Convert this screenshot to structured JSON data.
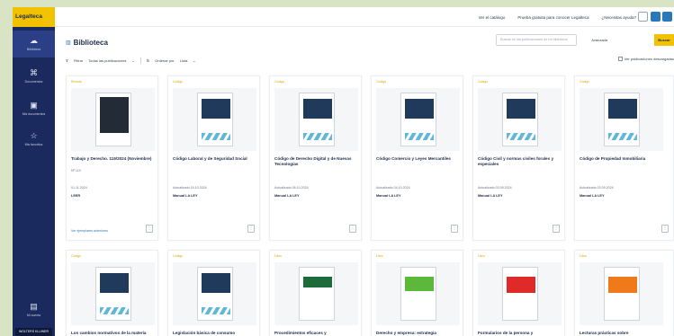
{
  "app": {
    "logo": "Legalteca"
  },
  "topbar": {
    "links": [
      "Ver el catálogo",
      "Prueba gratuita para conocer Legalteca",
      "¿Necesitas ayuda?"
    ]
  },
  "sidebar": {
    "items": [
      {
        "label": "Biblioteca",
        "icon": "cloud-icon"
      },
      {
        "label": "Documentos",
        "icon": "clip-icon"
      },
      {
        "label": "Mis documentos",
        "icon": "document-icon"
      },
      {
        "label": "Mis favoritos",
        "icon": "star-icon"
      }
    ],
    "bottom_item": {
      "label": "Mi cuenta",
      "icon": "archive-icon"
    },
    "bottom_logo": "WOLTERS KLUWER"
  },
  "main": {
    "title": "Biblioteca",
    "search_placeholder": "Buscar en las publicaciones de mi biblioteca",
    "advanced_search": "Avanzada",
    "search_button": "Buscar",
    "filter_label": "Filtrar",
    "filter_value": "Todas las publicaciones",
    "sort_label": "Ordenar por",
    "sort_value": "Lista",
    "show_all_label": "Ver publicaciones descargadas"
  },
  "cards": [
    {
      "tag": "Revista",
      "title": "Trabajo y Derecho. 119/2024 (Noviembre)",
      "sub": "Nº 119",
      "date": "01.11.2024",
      "access": "LEER",
      "more": "Ver ejemplares anteriores",
      "style": "dark"
    },
    {
      "tag": "Código",
      "title": "Código Laboral y de Seguridad Social",
      "sub": "",
      "date": "Actualizado 15.10.2024",
      "access": "Manual LA LEY",
      "more": "",
      "style": "code"
    },
    {
      "tag": "Código",
      "title": "Código de Derecho Digital y de Nuevas Tecnologías",
      "sub": "",
      "date": "Actualizado 06.10.2024",
      "access": "Manual LA LEY",
      "more": "",
      "style": "code"
    },
    {
      "tag": "Código",
      "title": "Código Comercio y Leyes Mercantiles",
      "sub": "",
      "date": "Actualizado 04.10.2024",
      "access": "Manual LA LEY",
      "more": "",
      "style": "code"
    },
    {
      "tag": "Código",
      "title": "Código Civil y normas civiles forales y especiales",
      "sub": "",
      "date": "Actualizado 03.09.2024",
      "access": "Manual LA LEY",
      "more": "",
      "style": "code"
    },
    {
      "tag": "Código",
      "title": "Código de Propiedad Inmobiliaria",
      "sub": "",
      "date": "Actualizado 03.09.2024",
      "access": "Manual LA LEY",
      "more": "",
      "style": "code"
    },
    {
      "tag": "Código",
      "title": "Los cambios normativos de la materia",
      "style": "code"
    },
    {
      "tag": "Código",
      "title": "Legislación básica de consumo",
      "style": "code"
    },
    {
      "tag": "Libro",
      "title": "Procedimientos eficaces y",
      "style": "green"
    },
    {
      "tag": "Libro",
      "title": "Derecho y empresa: estrategia",
      "style": "lgreen"
    },
    {
      "tag": "Libro",
      "title": "Formularios de la persona y",
      "style": "red"
    },
    {
      "tag": "Libro",
      "title": "Lecturas prácticas sobre",
      "style": "orange"
    }
  ]
}
